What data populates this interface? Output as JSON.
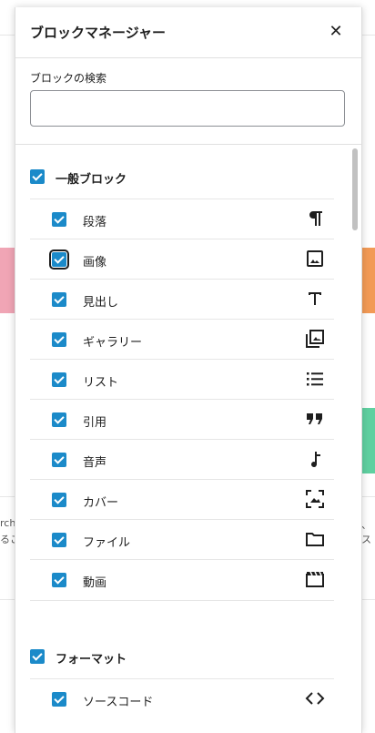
{
  "background": {
    "snippet_left_1": "rch",
    "snippet_left_2": "るこ",
    "snippet_right": "、ス"
  },
  "modal": {
    "title": "ブロックマネージャー",
    "close_glyph": "✕"
  },
  "search": {
    "label": "ブロックの検索",
    "value": "",
    "placeholder": ""
  },
  "categories": [
    {
      "label": "一般ブロック",
      "checked": true,
      "blocks": [
        {
          "label": "段落",
          "icon": "paragraph-icon"
        },
        {
          "label": "画像",
          "icon": "image-icon"
        },
        {
          "label": "見出し",
          "icon": "heading-icon"
        },
        {
          "label": "ギャラリー",
          "icon": "gallery-icon"
        },
        {
          "label": "リスト",
          "icon": "list-icon"
        },
        {
          "label": "引用",
          "icon": "quote-icon"
        },
        {
          "label": "音声",
          "icon": "audio-icon"
        },
        {
          "label": "カバー",
          "icon": "cover-icon"
        },
        {
          "label": "ファイル",
          "icon": "file-icon"
        },
        {
          "label": "動画",
          "icon": "video-icon"
        }
      ]
    },
    {
      "label": "フォーマット",
      "checked": true,
      "blocks": [
        {
          "label": "ソースコード",
          "icon": "code-icon"
        }
      ]
    }
  ],
  "colors": {
    "checkbox": "#1b8ac9",
    "accent_pink": "#f0a5b5",
    "accent_orange": "#f29a56",
    "accent_green": "#5fd0a0"
  }
}
